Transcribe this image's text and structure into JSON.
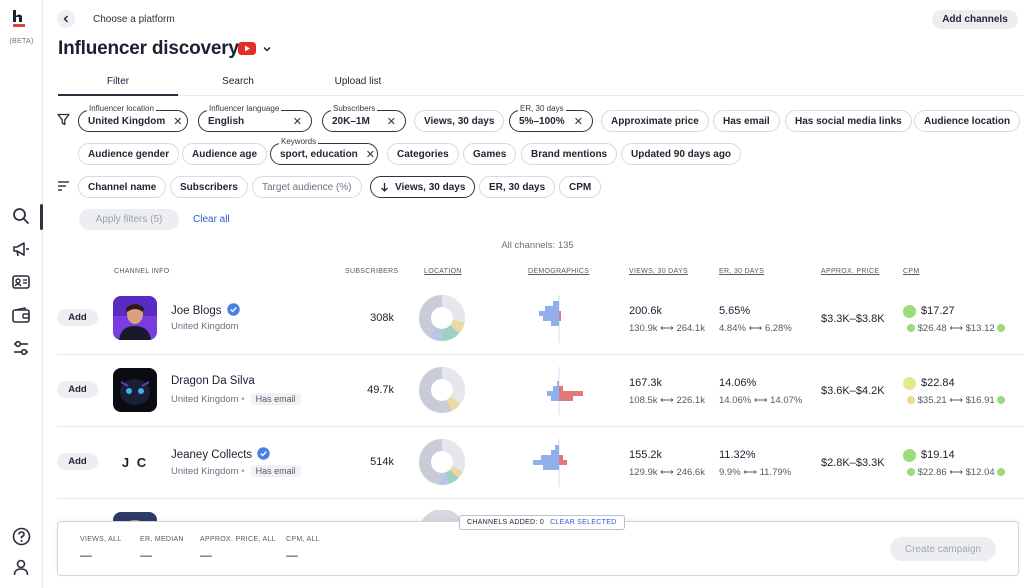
{
  "app": {
    "beta": "(BETA)"
  },
  "header": {
    "back_label": "Choose a platform",
    "add_channels": "Add channels",
    "title": "Influencer discovery"
  },
  "tabs": [
    {
      "label": "Filter",
      "active": true
    },
    {
      "label": "Search",
      "active": false
    },
    {
      "label": "Upload list",
      "active": false
    }
  ],
  "filters": {
    "influencer_location": {
      "label": "Influencer location",
      "value": "United Kingdom"
    },
    "influencer_language": {
      "label": "Influencer language",
      "value": "English"
    },
    "subscribers": {
      "label": "Subscribers",
      "value": "20K–1M"
    },
    "views_30": "Views, 30 days",
    "er_30": {
      "label": "ER, 30 days",
      "value": "5%–100%"
    },
    "approx_price": "Approximate price",
    "has_email": "Has email",
    "has_social": "Has social media links",
    "audience_location": "Audience location",
    "audience_gender": "Audience gender",
    "audience_age": "Audience age",
    "keywords": {
      "label": "Keywords",
      "value": "sport, education"
    },
    "categories": "Categories",
    "games": "Games",
    "brand_mentions": "Brand mentions",
    "updated": "Updated 90 days ago"
  },
  "sort": {
    "channel_name": "Channel name",
    "subscribers": "Subscribers",
    "target_audience": "Target audience (%)",
    "views_30": "Views, 30 days",
    "er_30": "ER, 30 days",
    "cpm": "CPM"
  },
  "actions": {
    "apply": "Apply filters (5)",
    "clear_all": "Clear all",
    "all_channels": "All channels: 135"
  },
  "table_headers": {
    "channel_info": "CHANNEL INFO",
    "subscribers": "SUBSCRIBERS",
    "location": "LOCATION",
    "demographics": "DEMOGRAPHICS",
    "views": "VIEWS, 30 DAYS",
    "er": "ER, 30 DAYS",
    "price": "APPROX. PRICE",
    "cpm": "CPM"
  },
  "rows": [
    {
      "add": "Add",
      "name": "Joe Blogs",
      "country": "United Kingdom",
      "email": "",
      "subscribers": "308k",
      "views": "200.6k",
      "views_range_low": "130.9k",
      "views_range_high": "264.1k",
      "er": "5.65%",
      "er_range_low": "4.84%",
      "er_range_high": "6.28%",
      "price": "$3.3K–$3.8K",
      "cpm": "$17.27",
      "cpm_low": "$26.48",
      "cpm_high": "$13.12",
      "cpm_color": "#9bdb7a",
      "cpm_low_color": "#9bdb7a",
      "cpm_high_color": "#9bdb7a"
    },
    {
      "add": "Add",
      "name": "Dragon Da Silva",
      "country": "United Kingdom",
      "email": "Has email",
      "subscribers": "49.7k",
      "views": "167.3k",
      "views_range_low": "108.5k",
      "views_range_high": "226.1k",
      "er": "14.06%",
      "er_range_low": "14.06%",
      "er_range_high": "14.07%",
      "price": "$3.6K–$4.2K",
      "cpm": "$22.84",
      "cpm_low": "$35.21",
      "cpm_high": "$16.91",
      "cpm_color": "#e4ea8a",
      "cpm_low_color": "#f2db8a",
      "cpm_high_color": "#9bdb7a"
    },
    {
      "add": "Add",
      "name": "Jeaney Collects",
      "initials": "J C",
      "country": "United Kingdom",
      "email": "Has email",
      "subscribers": "514k",
      "views": "155.2k",
      "views_range_low": "129.9k",
      "views_range_high": "246.6k",
      "er": "11.32%",
      "er_range_low": "9.9%",
      "er_range_high": "11.79%",
      "price": "$2.8K–$3.3K",
      "cpm": "$19.14",
      "cpm_low": "$22.86",
      "cpm_high": "$12.04",
      "cpm_color": "#9bdb7a",
      "cpm_low_color": "#9bdb7a",
      "cpm_high_color": "#9bdb7a"
    }
  ],
  "bottom": {
    "channels_added": "CHANNELS ADDED: 0",
    "clear_selected": "CLEAR SELECTED",
    "views_all": "VIEWS, ALL",
    "er_median": "ER, MEDIAN",
    "approx_price_all": "APPROX. PRICE, ALL",
    "cpm_all": "CPM, ALL",
    "dash": "—",
    "create": "Create campaign"
  }
}
